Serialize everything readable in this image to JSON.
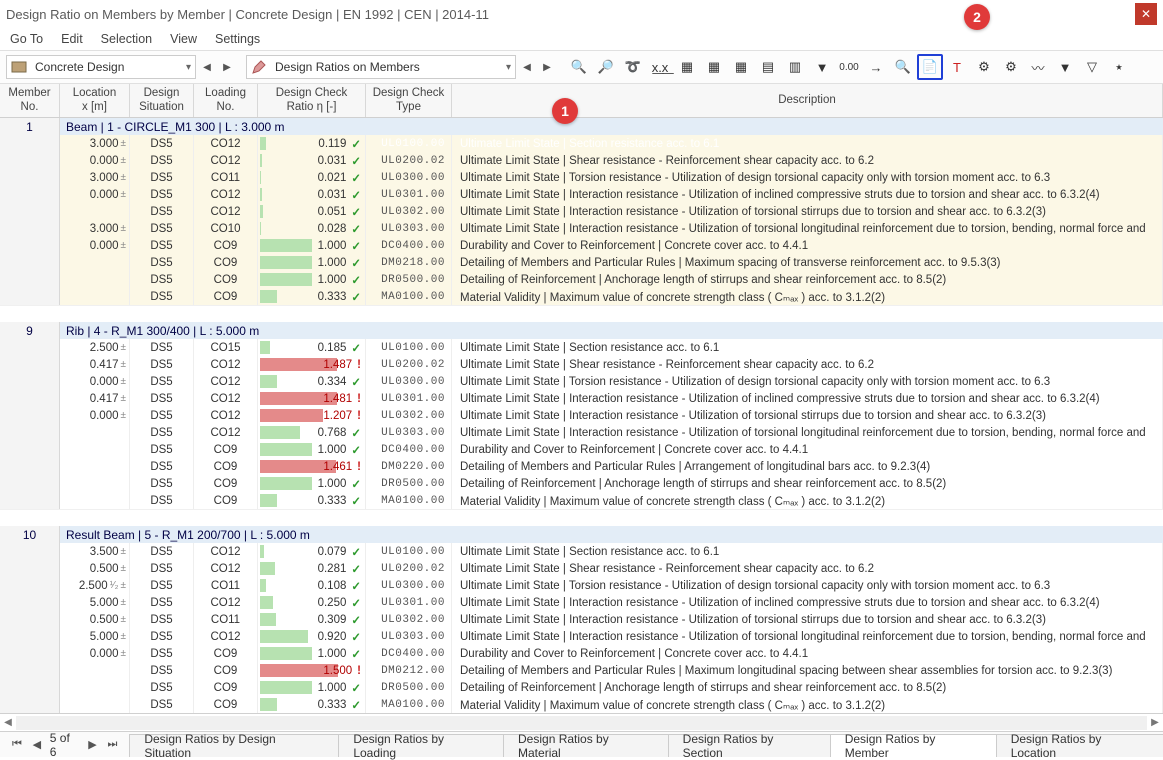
{
  "title": "Design Ratio on Members by Member | Concrete Design | EN 1992 | CEN | 2014-11",
  "menubar": [
    "Go To",
    "Edit",
    "Selection",
    "View",
    "Settings"
  ],
  "combo1": "Concrete Design",
  "combo2": "Design Ratios on Members",
  "callouts": {
    "one": "1",
    "two": "2"
  },
  "headers": {
    "memberNo": "Member\nNo.",
    "location": "Location\nx [m]",
    "designSit": "Design\nSituation",
    "loadingNo": "Loading\nNo.",
    "ratio": "Design Check\nRatio η [-]",
    "type": "Design Check\nType",
    "desc": "Description"
  },
  "groups": [
    {
      "no": "1",
      "label": "Beam | 1 - CIRCLE_M1 300 | L : 3.000 m",
      "beige": true,
      "rows": [
        {
          "loc": "3.000",
          "ds": "DS5",
          "lo": "CO12",
          "ratio": 0.119,
          "over": false,
          "type": "UL0100.00",
          "desc": "Ultimate Limit State | Section resistance acc. to 6.1",
          "sel": true
        },
        {
          "loc": "0.000",
          "ds": "DS5",
          "lo": "CO12",
          "ratio": 0.031,
          "over": false,
          "type": "UL0200.02",
          "desc": "Ultimate Limit State | Shear resistance - Reinforcement shear capacity acc. to 6.2"
        },
        {
          "loc": "3.000",
          "ds": "DS5",
          "lo": "CO11",
          "ratio": 0.021,
          "over": false,
          "type": "UL0300.00",
          "desc": "Ultimate Limit State | Torsion resistance - Utilization of design torsional capacity only with torsion moment acc. to 6.3"
        },
        {
          "loc": "0.000",
          "ds": "DS5",
          "lo": "CO12",
          "ratio": 0.031,
          "over": false,
          "type": "UL0301.00",
          "desc": "Ultimate Limit State | Interaction resistance - Utilization of inclined compressive struts due to torsion and shear acc. to 6.3.2(4)"
        },
        {
          "loc": "",
          "ds": "DS5",
          "lo": "CO12",
          "ratio": 0.051,
          "over": false,
          "type": "UL0302.00",
          "desc": "Ultimate Limit State | Interaction resistance - Utilization of torsional stirrups due to torsion and shear acc. to 6.3.2(3)"
        },
        {
          "loc": "3.000",
          "ds": "DS5",
          "lo": "CO10",
          "ratio": 0.028,
          "over": false,
          "type": "UL0303.00",
          "desc": "Ultimate Limit State | Interaction resistance - Utilization of torsional longitudinal reinforcement due to torsion, bending, normal force and"
        },
        {
          "loc": "0.000",
          "ds": "DS5",
          "lo": "CO9",
          "ratio": 1.0,
          "over": false,
          "type": "DC0400.00",
          "desc": "Durability and Cover to Reinforcement | Concrete cover acc. to 4.4.1"
        },
        {
          "loc": "",
          "ds": "DS5",
          "lo": "CO9",
          "ratio": 1.0,
          "over": false,
          "type": "DM0218.00",
          "desc": "Detailing of Members and Particular Rules | Maximum spacing of transverse reinforcement acc. to 9.5.3(3)"
        },
        {
          "loc": "",
          "ds": "DS5",
          "lo": "CO9",
          "ratio": 1.0,
          "over": false,
          "type": "DR0500.00",
          "desc": "Detailing of Reinforcement | Anchorage length of stirrups and shear reinforcement acc. to 8.5(2)"
        },
        {
          "loc": "",
          "ds": "DS5",
          "lo": "CO9",
          "ratio": 0.333,
          "over": false,
          "type": "MA0100.00",
          "desc": "Material Validity | Maximum value of concrete strength class ( Cₘₐₓ ) acc. to 3.1.2(2)"
        }
      ]
    },
    {
      "no": "9",
      "label": "Rib | 4 - R_M1 300/400 | L : 5.000 m",
      "beige": false,
      "rows": [
        {
          "loc": "2.500",
          "ds": "DS5",
          "lo": "CO15",
          "ratio": 0.185,
          "over": false,
          "type": "UL0100.00",
          "desc": "Ultimate Limit State | Section resistance acc. to 6.1"
        },
        {
          "loc": "0.417",
          "ds": "DS5",
          "lo": "CO12",
          "ratio": 1.487,
          "over": true,
          "type": "UL0200.02",
          "desc": "Ultimate Limit State | Shear resistance - Reinforcement shear capacity acc. to 6.2"
        },
        {
          "loc": "0.000",
          "ds": "DS5",
          "lo": "CO12",
          "ratio": 0.334,
          "over": false,
          "type": "UL0300.00",
          "desc": "Ultimate Limit State | Torsion resistance - Utilization of design torsional capacity only with torsion moment acc. to 6.3"
        },
        {
          "loc": "0.417",
          "ds": "DS5",
          "lo": "CO12",
          "ratio": 1.481,
          "over": true,
          "type": "UL0301.00",
          "desc": "Ultimate Limit State | Interaction resistance - Utilization of inclined compressive struts due to torsion and shear acc. to 6.3.2(4)"
        },
        {
          "loc": "0.000",
          "ds": "DS5",
          "lo": "CO12",
          "ratio": 1.207,
          "over": true,
          "type": "UL0302.00",
          "desc": "Ultimate Limit State | Interaction resistance - Utilization of torsional stirrups due to torsion and shear acc. to 6.3.2(3)"
        },
        {
          "loc": "",
          "ds": "DS5",
          "lo": "CO12",
          "ratio": 0.768,
          "over": false,
          "type": "UL0303.00",
          "desc": "Ultimate Limit State | Interaction resistance - Utilization of torsional longitudinal reinforcement due to torsion, bending, normal force and"
        },
        {
          "loc": "",
          "ds": "DS5",
          "lo": "CO9",
          "ratio": 1.0,
          "over": false,
          "type": "DC0400.00",
          "desc": "Durability and Cover to Reinforcement | Concrete cover acc. to 4.4.1"
        },
        {
          "loc": "",
          "ds": "DS5",
          "lo": "CO9",
          "ratio": 1.461,
          "over": true,
          "type": "DM0220.00",
          "desc": "Detailing of Members and Particular Rules | Arrangement of longitudinal bars acc. to 9.2.3(4)"
        },
        {
          "loc": "",
          "ds": "DS5",
          "lo": "CO9",
          "ratio": 1.0,
          "over": false,
          "type": "DR0500.00",
          "desc": "Detailing of Reinforcement | Anchorage length of stirrups and shear reinforcement acc. to 8.5(2)"
        },
        {
          "loc": "",
          "ds": "DS5",
          "lo": "CO9",
          "ratio": 0.333,
          "over": false,
          "type": "MA0100.00",
          "desc": "Material Validity | Maximum value of concrete strength class ( Cₘₐₓ ) acc. to 3.1.2(2)"
        }
      ]
    },
    {
      "no": "10",
      "label": "Result Beam | 5 - R_M1 200/700 | L : 5.000 m",
      "beige": false,
      "rows": [
        {
          "loc": "3.500",
          "ds": "DS5",
          "lo": "CO12",
          "ratio": 0.079,
          "over": false,
          "type": "UL0100.00",
          "desc": "Ultimate Limit State | Section resistance acc. to 6.1"
        },
        {
          "loc": "0.500",
          "ds": "DS5",
          "lo": "CO12",
          "ratio": 0.281,
          "over": false,
          "type": "UL0200.02",
          "desc": "Ultimate Limit State | Shear resistance - Reinforcement shear capacity acc. to 6.2"
        },
        {
          "loc": "2.500",
          "half": true,
          "ds": "DS5",
          "lo": "CO11",
          "ratio": 0.108,
          "over": false,
          "type": "UL0300.00",
          "desc": "Ultimate Limit State | Torsion resistance - Utilization of design torsional capacity only with torsion moment acc. to 6.3"
        },
        {
          "loc": "5.000",
          "ds": "DS5",
          "lo": "CO12",
          "ratio": 0.25,
          "over": false,
          "type": "UL0301.00",
          "desc": "Ultimate Limit State | Interaction resistance - Utilization of inclined compressive struts due to torsion and shear acc. to 6.3.2(4)"
        },
        {
          "loc": "0.500",
          "ds": "DS5",
          "lo": "CO11",
          "ratio": 0.309,
          "over": false,
          "type": "UL0302.00",
          "desc": "Ultimate Limit State | Interaction resistance - Utilization of torsional stirrups due to torsion and shear acc. to 6.3.2(3)"
        },
        {
          "loc": "5.000",
          "ds": "DS5",
          "lo": "CO12",
          "ratio": 0.92,
          "over": false,
          "type": "UL0303.00",
          "desc": "Ultimate Limit State | Interaction resistance - Utilization of torsional longitudinal reinforcement due to torsion, bending, normal force and"
        },
        {
          "loc": "0.000",
          "ds": "DS5",
          "lo": "CO9",
          "ratio": 1.0,
          "over": false,
          "type": "DC0400.00",
          "desc": "Durability and Cover to Reinforcement | Concrete cover acc. to 4.4.1"
        },
        {
          "loc": "",
          "ds": "DS5",
          "lo": "CO9",
          "ratio": 1.5,
          "over": true,
          "type": "DM0212.00",
          "desc": "Detailing of Members and Particular Rules | Maximum longitudinal spacing between shear assemblies for torsion acc. to 9.2.3(3)"
        },
        {
          "loc": "",
          "ds": "DS5",
          "lo": "CO9",
          "ratio": 1.0,
          "over": false,
          "type": "DR0500.00",
          "desc": "Detailing of Reinforcement | Anchorage length of stirrups and shear reinforcement acc. to 8.5(2)"
        },
        {
          "loc": "",
          "ds": "DS5",
          "lo": "CO9",
          "ratio": 0.333,
          "over": false,
          "type": "MA0100.00",
          "desc": "Material Validity | Maximum value of concrete strength class ( Cₘₐₓ ) acc. to 3.1.2(2)"
        }
      ]
    }
  ],
  "pager": "5 of 6",
  "tabs": [
    "Design Ratios by Design Situation",
    "Design Ratios by Loading",
    "Design Ratios by Material",
    "Design Ratios by Section",
    "Design Ratios by Member",
    "Design Ratios by Location"
  ],
  "activeTab": 4,
  "toolbar_icons": [
    "zoom-sel",
    "zoom-clear",
    "filter-arrow",
    "ruler-x",
    "table",
    "table-yellow",
    "table-green",
    "sheet-green",
    "sheet-excel",
    "funnel",
    "decimals",
    "arrow-right",
    "magnifier",
    "page-find",
    "red-T",
    "tools-1",
    "tools-2",
    "wave",
    "funnel-blue",
    "funnel-arrow",
    "funnel-star"
  ]
}
